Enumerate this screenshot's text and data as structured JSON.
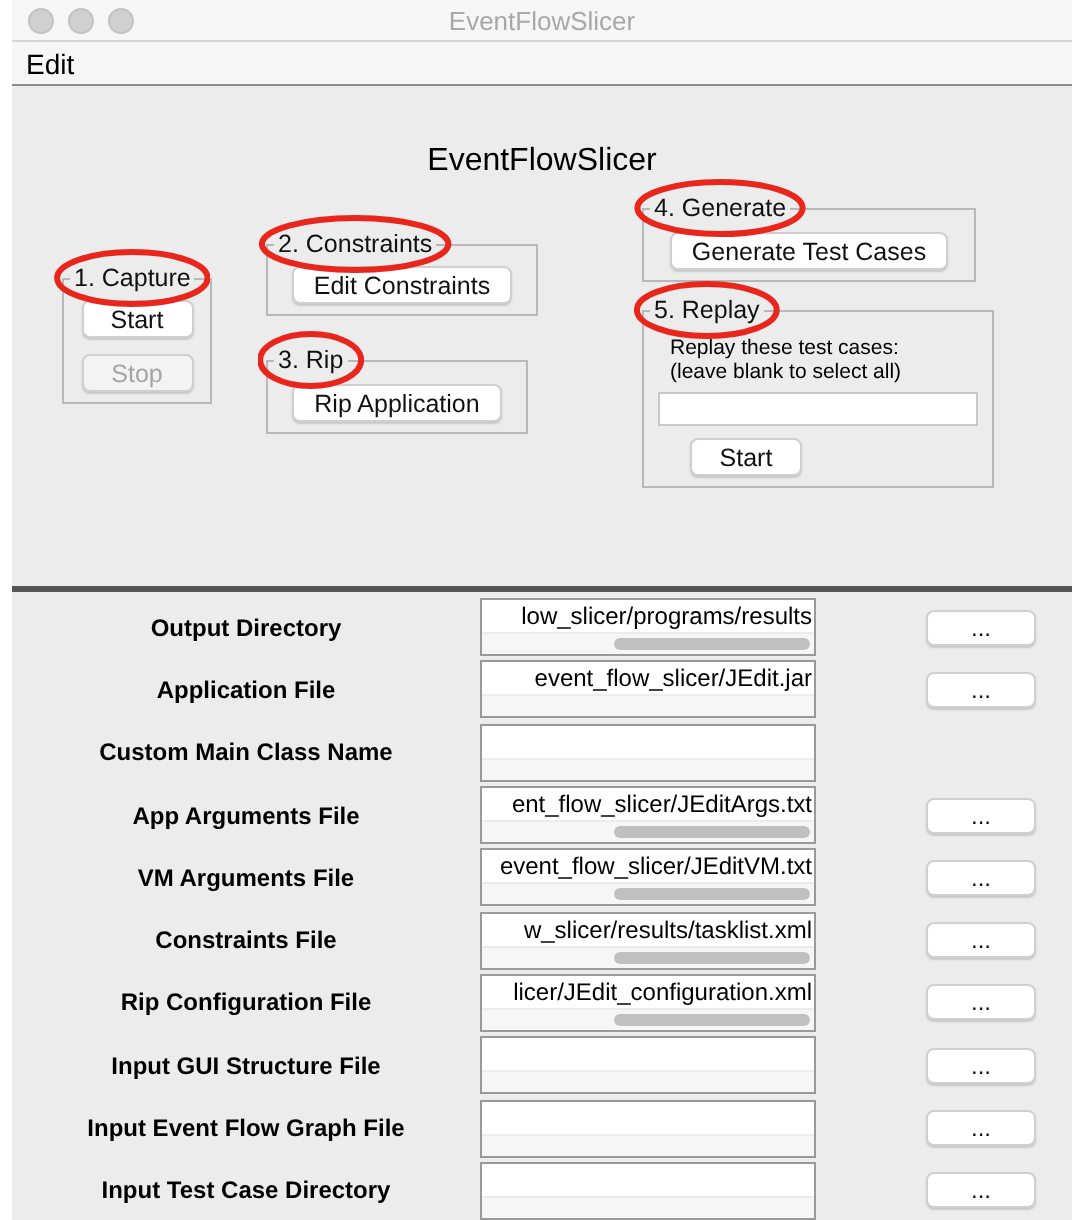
{
  "window": {
    "title": "EventFlowSlicer"
  },
  "menu": [
    "Edit"
  ],
  "heading": "EventFlowSlicer",
  "groups": {
    "capture": {
      "legend": "1. Capture",
      "highlighted": true,
      "buttons": [
        {
          "label": "Start",
          "disabled": false
        },
        {
          "label": "Stop",
          "disabled": true
        }
      ]
    },
    "constraints": {
      "legend": "2. Constraints",
      "highlighted": true,
      "buttons": [
        {
          "label": "Edit Constraints",
          "disabled": false
        }
      ]
    },
    "rip": {
      "legend": "3. Rip",
      "highlighted": true,
      "buttons": [
        {
          "label": "Rip Application",
          "disabled": false
        }
      ]
    },
    "generate": {
      "legend": "4. Generate",
      "highlighted": true,
      "buttons": [
        {
          "label": "Generate Test Cases",
          "disabled": false
        }
      ]
    },
    "replay": {
      "legend": "5. Replay",
      "highlighted": true,
      "note": "Replay these test cases:",
      "note_2": "(leave blank to select all)",
      "buttons": [
        {
          "label": "Start",
          "disabled": false
        }
      ]
    }
  },
  "files": [
    {
      "label": "Output Directory",
      "value": "low_slicer/programs/results",
      "scroll_thumb": true,
      "browse": "..."
    },
    {
      "label": "Application File",
      "value": "event_flow_slicer/JEdit.jar",
      "scroll_thumb": false,
      "browse": "..."
    },
    {
      "label": "Custom Main Class Name",
      "scroll_thumb": false
    },
    {
      "label": "App Arguments File",
      "value": "ent_flow_slicer/JEditArgs.txt",
      "scroll_thumb": true,
      "browse": "..."
    },
    {
      "label": "VM Arguments File",
      "value": "event_flow_slicer/JEditVM.txt",
      "scroll_thumb": true,
      "browse": "..."
    },
    {
      "label": "Constraints File",
      "value": "w_slicer/results/tasklist.xml",
      "scroll_thumb": true,
      "browse": "..."
    },
    {
      "label": "Rip Configuration File",
      "value": "licer/JEdit_configuration.xml",
      "scroll_thumb": true,
      "browse": "..."
    },
    {
      "label": "Input GUI Structure File",
      "scroll_thumb": false,
      "browse": "..."
    },
    {
      "label": "Input Event Flow Graph File",
      "scroll_thumb": false,
      "browse": "..."
    },
    {
      "label": "Input Test Case Directory",
      "scroll_thumb": false,
      "browse": "..."
    }
  ]
}
